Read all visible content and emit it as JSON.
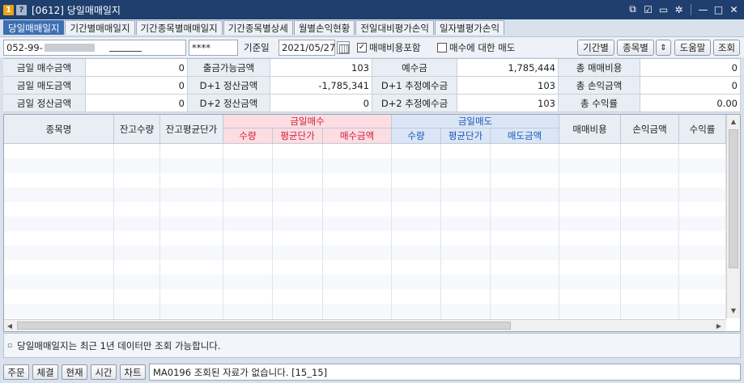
{
  "window": {
    "badge1": "1",
    "badge2": "?",
    "title": "[0612] 당일매매일지",
    "controls": [
      "⧉",
      "☑",
      "▭",
      "✲",
      "—",
      "□",
      "✕"
    ]
  },
  "tabs": [
    {
      "label": "당일매매일지",
      "active": true
    },
    {
      "label": "기간별매매일지"
    },
    {
      "label": "기간종목별매매일지"
    },
    {
      "label": "기간종목별상세"
    },
    {
      "label": "월별손익현황"
    },
    {
      "label": "전일대비평가손익"
    },
    {
      "label": "일자별평가손익"
    }
  ],
  "query": {
    "account_prefix": "052-99-",
    "password": "****",
    "date_label": "기준일",
    "date_value": "2021/05/27",
    "check_fee": {
      "label": "매매비용포함",
      "checked": true
    },
    "check_sell": {
      "label": "매수에 대한 매도",
      "checked": false
    },
    "buttons": {
      "period": "기간별",
      "stock": "종목별",
      "updown": "⇕",
      "help": "도움말",
      "query": "조회"
    }
  },
  "summary": [
    [
      "금일 매수금액",
      "0",
      "출금가능금액",
      "103",
      "예수금",
      "1,785,444",
      "총 매매비용",
      "0"
    ],
    [
      "금일 매도금액",
      "0",
      "D+1 정산금액",
      "-1,785,341",
      "D+1 추정예수금",
      "103",
      "총 손익금액",
      "0"
    ],
    [
      "금일 정산금액",
      "0",
      "D+2 정산금액",
      "0",
      "D+2 추정예수금",
      "103",
      "총 수익률",
      "0.00"
    ]
  ],
  "grid": {
    "headers": {
      "name": "종목명",
      "qty": "잔고수량",
      "avg": "잔고평균단가",
      "buy_group": "금일매수",
      "buy_qty": "수량",
      "buy_avg": "평균단가",
      "buy_amt": "매수금액",
      "sell_group": "금일매도",
      "sell_qty": "수량",
      "sell_avg": "평균단가",
      "sell_amt": "매도금액",
      "fee": "매매비용",
      "pnl": "손익금액",
      "rate": "수익률"
    },
    "buy_color": "#d01e34",
    "sell_color": "#1a56b8"
  },
  "info": {
    "marker": "▫",
    "text": "당일매매일지는 최근 1년 데이터만 조회 가능합니다."
  },
  "bottom": {
    "buttons": [
      "주문",
      "체결",
      "현재",
      "시간",
      "차트"
    ],
    "status": "MA0196 조회된 자료가 없습니다. [15_15]"
  }
}
